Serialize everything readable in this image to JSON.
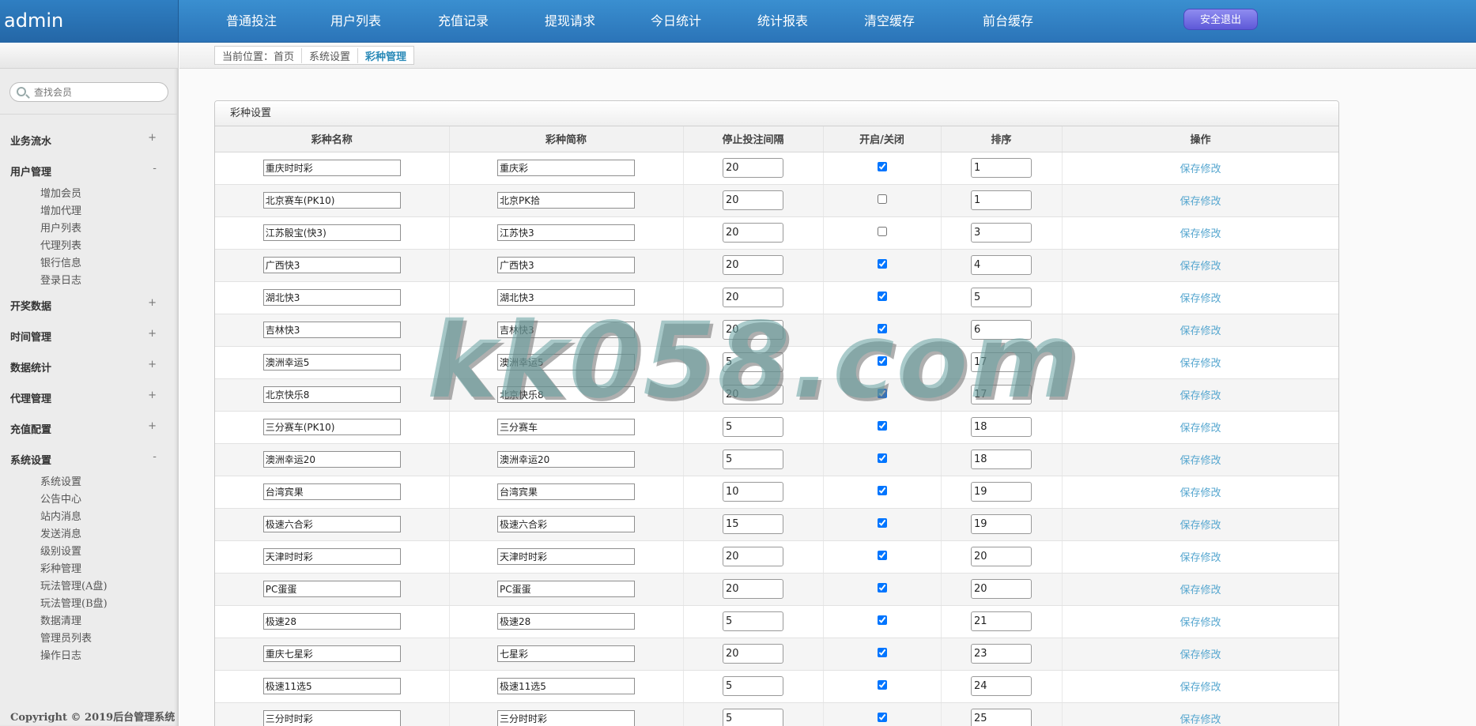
{
  "brand": "admin",
  "nav": [
    "普通投注",
    "用户列表",
    "充值记录",
    "提现请求",
    "今日统计",
    "统计报表",
    "清空缓存",
    "前台缓存"
  ],
  "logout_label": "安全退出",
  "search": {
    "placeholder": "查找会员"
  },
  "sidebar": {
    "groups": [
      {
        "label": "业务流水",
        "toggle": "+"
      },
      {
        "label": "用户管理",
        "toggle": "-"
      },
      {
        "label": "开奖数据",
        "toggle": "+"
      },
      {
        "label": "时间管理",
        "toggle": "+"
      },
      {
        "label": "数据统计",
        "toggle": "+"
      },
      {
        "label": "代理管理",
        "toggle": "+"
      },
      {
        "label": "充值配置",
        "toggle": "+"
      },
      {
        "label": "系统设置",
        "toggle": "-"
      }
    ],
    "user_sub": [
      "增加会员",
      "增加代理",
      "用户列表",
      "代理列表",
      "银行信息",
      "登录日志"
    ],
    "system_sub": [
      "系统设置",
      "公告中心",
      "站内消息",
      "发送消息",
      "级别设置",
      "彩种管理",
      "玩法管理(A盘)",
      "玩法管理(B盘)",
      "数据清理",
      "管理员列表",
      "操作日志"
    ],
    "copyright": "Copyright © 2019后台管理系统"
  },
  "breadcrumb": [
    "当前位置：首页",
    "系统设置",
    "彩种管理"
  ],
  "panel_title": "彩种设置",
  "table": {
    "headers": [
      "彩种名称",
      "彩种简称",
      "停止投注间隔",
      "开启/关闭",
      "排序",
      "操作"
    ],
    "action_label": "保存修改",
    "rows": [
      {
        "name": "重庆时时彩",
        "short": "重庆彩",
        "interval": "20",
        "enabled": true,
        "sort": "1"
      },
      {
        "name": "北京赛车(PK10)",
        "short": "北京PK拾",
        "interval": "20",
        "enabled": false,
        "sort": "1"
      },
      {
        "name": "江苏骰宝(快3)",
        "short": "江苏快3",
        "interval": "20",
        "enabled": false,
        "sort": "3"
      },
      {
        "name": "广西快3",
        "short": "广西快3",
        "interval": "20",
        "enabled": true,
        "sort": "4"
      },
      {
        "name": "湖北快3",
        "short": "湖北快3",
        "interval": "20",
        "enabled": true,
        "sort": "5"
      },
      {
        "name": "吉林快3",
        "short": "吉林快3",
        "interval": "20",
        "enabled": true,
        "sort": "6"
      },
      {
        "name": "澳洲幸运5",
        "short": "澳洲幸运5",
        "interval": "5",
        "enabled": true,
        "sort": "17"
      },
      {
        "name": "北京快乐8",
        "short": "北京快乐8",
        "interval": "20",
        "enabled": true,
        "sort": "17"
      },
      {
        "name": "三分赛车(PK10)",
        "short": "三分赛车",
        "interval": "5",
        "enabled": true,
        "sort": "18"
      },
      {
        "name": "澳洲幸运20",
        "short": "澳洲幸运20",
        "interval": "5",
        "enabled": true,
        "sort": "18"
      },
      {
        "name": "台湾宾果",
        "short": "台湾宾果",
        "interval": "10",
        "enabled": true,
        "sort": "19"
      },
      {
        "name": "极速六合彩",
        "short": "极速六合彩",
        "interval": "15",
        "enabled": true,
        "sort": "19"
      },
      {
        "name": "天津时时彩",
        "short": "天津时时彩",
        "interval": "20",
        "enabled": true,
        "sort": "20"
      },
      {
        "name": "PC蛋蛋",
        "short": "PC蛋蛋",
        "interval": "20",
        "enabled": true,
        "sort": "20"
      },
      {
        "name": "极速28",
        "short": "极速28",
        "interval": "5",
        "enabled": true,
        "sort": "21"
      },
      {
        "name": "重庆七星彩",
        "short": "七星彩",
        "interval": "20",
        "enabled": true,
        "sort": "23"
      },
      {
        "name": "极速11选5",
        "short": "极速11选5",
        "interval": "5",
        "enabled": true,
        "sort": "24"
      },
      {
        "name": "三分时时彩",
        "short": "三分时时彩",
        "interval": "5",
        "enabled": true,
        "sort": "25"
      }
    ]
  },
  "watermark": "kk058.com"
}
